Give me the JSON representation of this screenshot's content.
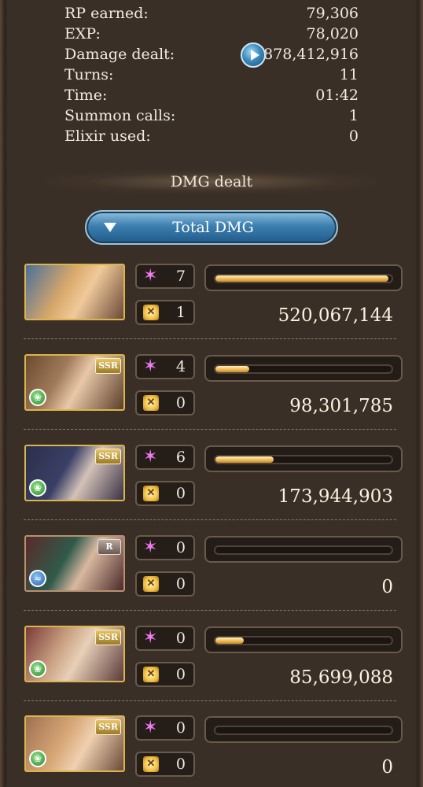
{
  "stats": [
    {
      "label": "RP earned:",
      "value": "79,306"
    },
    {
      "label": "EXP:",
      "value": "78,020"
    },
    {
      "label": "Damage dealt:",
      "value": "878,412,916"
    },
    {
      "label": "Turns:",
      "value": "11"
    },
    {
      "label": "Time:",
      "value": "01:42"
    },
    {
      "label": "Summon calls:",
      "value": "1"
    },
    {
      "label": "Elixir used:",
      "value": "0"
    }
  ],
  "section": {
    "title": "DMG dealt"
  },
  "filter": {
    "label": "Total DMG"
  },
  "characters": [
    {
      "rarity": "",
      "element": "",
      "skills": "7",
      "charge_attacks": "1",
      "damage": "520,067,144",
      "damage_ratio": 0.98
    },
    {
      "rarity": "SSR",
      "element": "wind",
      "skills": "4",
      "charge_attacks": "0",
      "damage": "98,301,785",
      "damage_ratio": 0.19
    },
    {
      "rarity": "SSR",
      "element": "wind",
      "skills": "6",
      "charge_attacks": "0",
      "damage": "173,944,903",
      "damage_ratio": 0.33
    },
    {
      "rarity": "R",
      "element": "water",
      "skills": "0",
      "charge_attacks": "0",
      "damage": "0",
      "damage_ratio": 0
    },
    {
      "rarity": "SSR",
      "element": "wind",
      "skills": "0",
      "charge_attacks": "0",
      "damage": "85,699,088",
      "damage_ratio": 0.16
    },
    {
      "rarity": "SSR",
      "element": "wind",
      "skills": "0",
      "charge_attacks": "0",
      "damage": "0",
      "damage_ratio": 0
    }
  ],
  "colors": {
    "bar_fill": "#f0c060",
    "accent": "#3d7fb0"
  }
}
